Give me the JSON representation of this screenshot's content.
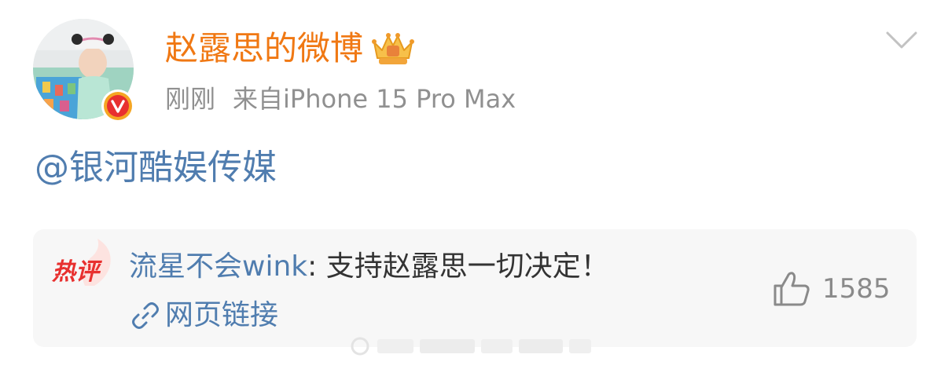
{
  "post": {
    "author": "赵露思的微博",
    "time": "刚刚",
    "source": "来自iPhone 15 Pro Max",
    "content": "@银河酷娱传媒"
  },
  "hot_comment": {
    "badge": "热评",
    "user": "流星不会wink",
    "separator": ": ",
    "text": "支持赵露思一切决定！",
    "link_label": "网页链接",
    "likes": "1585"
  },
  "icons": {
    "avatar": "avatar-photo",
    "verified": "verified-badge-icon",
    "crown": "crown-icon",
    "chevron": "chevron-down-icon",
    "link": "link-icon",
    "like": "thumbs-up-icon"
  },
  "colors": {
    "author": "#f07813",
    "link_blue": "#507daf",
    "meta_gray": "#909090",
    "comment_bg": "#f7f7f7",
    "hot_red": "#e8302f",
    "verified_orange": "#f5a623"
  }
}
